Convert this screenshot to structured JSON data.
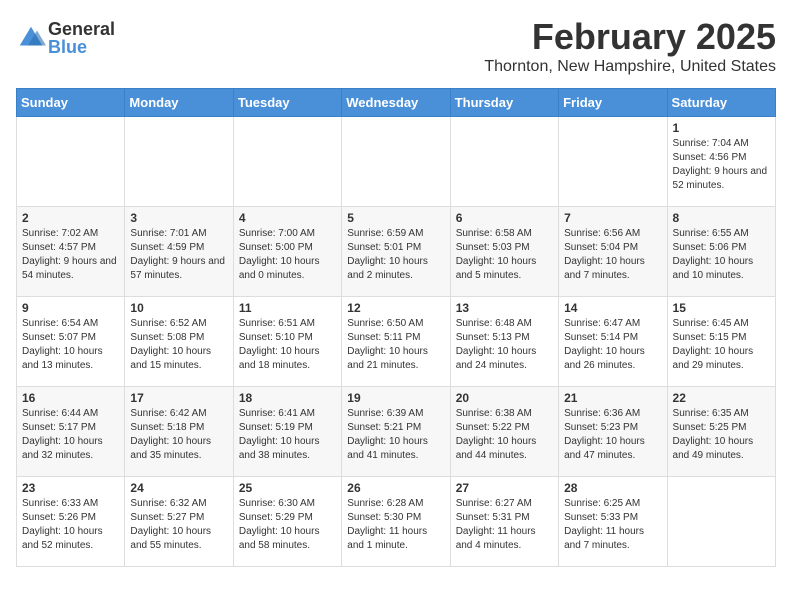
{
  "logo": {
    "general": "General",
    "blue": "Blue"
  },
  "header": {
    "month": "February 2025",
    "location": "Thornton, New Hampshire, United States"
  },
  "weekdays": [
    "Sunday",
    "Monday",
    "Tuesday",
    "Wednesday",
    "Thursday",
    "Friday",
    "Saturday"
  ],
  "weeks": [
    [
      {
        "day": "",
        "info": ""
      },
      {
        "day": "",
        "info": ""
      },
      {
        "day": "",
        "info": ""
      },
      {
        "day": "",
        "info": ""
      },
      {
        "day": "",
        "info": ""
      },
      {
        "day": "",
        "info": ""
      },
      {
        "day": "1",
        "info": "Sunrise: 7:04 AM\nSunset: 4:56 PM\nDaylight: 9 hours and 52 minutes."
      }
    ],
    [
      {
        "day": "2",
        "info": "Sunrise: 7:02 AM\nSunset: 4:57 PM\nDaylight: 9 hours and 54 minutes."
      },
      {
        "day": "3",
        "info": "Sunrise: 7:01 AM\nSunset: 4:59 PM\nDaylight: 9 hours and 57 minutes."
      },
      {
        "day": "4",
        "info": "Sunrise: 7:00 AM\nSunset: 5:00 PM\nDaylight: 10 hours and 0 minutes."
      },
      {
        "day": "5",
        "info": "Sunrise: 6:59 AM\nSunset: 5:01 PM\nDaylight: 10 hours and 2 minutes."
      },
      {
        "day": "6",
        "info": "Sunrise: 6:58 AM\nSunset: 5:03 PM\nDaylight: 10 hours and 5 minutes."
      },
      {
        "day": "7",
        "info": "Sunrise: 6:56 AM\nSunset: 5:04 PM\nDaylight: 10 hours and 7 minutes."
      },
      {
        "day": "8",
        "info": "Sunrise: 6:55 AM\nSunset: 5:06 PM\nDaylight: 10 hours and 10 minutes."
      }
    ],
    [
      {
        "day": "9",
        "info": "Sunrise: 6:54 AM\nSunset: 5:07 PM\nDaylight: 10 hours and 13 minutes."
      },
      {
        "day": "10",
        "info": "Sunrise: 6:52 AM\nSunset: 5:08 PM\nDaylight: 10 hours and 15 minutes."
      },
      {
        "day": "11",
        "info": "Sunrise: 6:51 AM\nSunset: 5:10 PM\nDaylight: 10 hours and 18 minutes."
      },
      {
        "day": "12",
        "info": "Sunrise: 6:50 AM\nSunset: 5:11 PM\nDaylight: 10 hours and 21 minutes."
      },
      {
        "day": "13",
        "info": "Sunrise: 6:48 AM\nSunset: 5:13 PM\nDaylight: 10 hours and 24 minutes."
      },
      {
        "day": "14",
        "info": "Sunrise: 6:47 AM\nSunset: 5:14 PM\nDaylight: 10 hours and 26 minutes."
      },
      {
        "day": "15",
        "info": "Sunrise: 6:45 AM\nSunset: 5:15 PM\nDaylight: 10 hours and 29 minutes."
      }
    ],
    [
      {
        "day": "16",
        "info": "Sunrise: 6:44 AM\nSunset: 5:17 PM\nDaylight: 10 hours and 32 minutes."
      },
      {
        "day": "17",
        "info": "Sunrise: 6:42 AM\nSunset: 5:18 PM\nDaylight: 10 hours and 35 minutes."
      },
      {
        "day": "18",
        "info": "Sunrise: 6:41 AM\nSunset: 5:19 PM\nDaylight: 10 hours and 38 minutes."
      },
      {
        "day": "19",
        "info": "Sunrise: 6:39 AM\nSunset: 5:21 PM\nDaylight: 10 hours and 41 minutes."
      },
      {
        "day": "20",
        "info": "Sunrise: 6:38 AM\nSunset: 5:22 PM\nDaylight: 10 hours and 44 minutes."
      },
      {
        "day": "21",
        "info": "Sunrise: 6:36 AM\nSunset: 5:23 PM\nDaylight: 10 hours and 47 minutes."
      },
      {
        "day": "22",
        "info": "Sunrise: 6:35 AM\nSunset: 5:25 PM\nDaylight: 10 hours and 49 minutes."
      }
    ],
    [
      {
        "day": "23",
        "info": "Sunrise: 6:33 AM\nSunset: 5:26 PM\nDaylight: 10 hours and 52 minutes."
      },
      {
        "day": "24",
        "info": "Sunrise: 6:32 AM\nSunset: 5:27 PM\nDaylight: 10 hours and 55 minutes."
      },
      {
        "day": "25",
        "info": "Sunrise: 6:30 AM\nSunset: 5:29 PM\nDaylight: 10 hours and 58 minutes."
      },
      {
        "day": "26",
        "info": "Sunrise: 6:28 AM\nSunset: 5:30 PM\nDaylight: 11 hours and 1 minute."
      },
      {
        "day": "27",
        "info": "Sunrise: 6:27 AM\nSunset: 5:31 PM\nDaylight: 11 hours and 4 minutes."
      },
      {
        "day": "28",
        "info": "Sunrise: 6:25 AM\nSunset: 5:33 PM\nDaylight: 11 hours and 7 minutes."
      },
      {
        "day": "",
        "info": ""
      }
    ]
  ]
}
